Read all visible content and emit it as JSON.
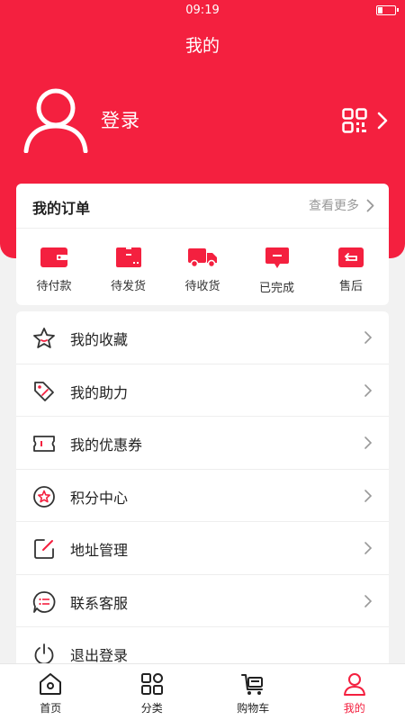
{
  "status_bar": {
    "time": "09:19"
  },
  "header": {
    "title": "我的"
  },
  "profile": {
    "login_label": "登录"
  },
  "orders": {
    "title": "我的订单",
    "more_label": "查看更多",
    "items": [
      {
        "label": "待付款",
        "icon": "wallet-icon"
      },
      {
        "label": "待发货",
        "icon": "box-icon"
      },
      {
        "label": "待收货",
        "icon": "truck-icon"
      },
      {
        "label": "已完成",
        "icon": "message-check-icon"
      },
      {
        "label": "售后",
        "icon": "return-icon"
      }
    ]
  },
  "menu": {
    "items": [
      {
        "label": "我的收藏",
        "icon": "star-icon"
      },
      {
        "label": "我的助力",
        "icon": "tag-icon"
      },
      {
        "label": "我的优惠券",
        "icon": "coupon-icon"
      },
      {
        "label": "积分中心",
        "icon": "points-star-icon"
      },
      {
        "label": "地址管理",
        "icon": "edit-address-icon"
      },
      {
        "label": "联系客服",
        "icon": "chat-icon"
      },
      {
        "label": "退出登录",
        "icon": "power-icon"
      }
    ]
  },
  "tabbar": {
    "items": [
      {
        "label": "首页",
        "icon": "home-icon"
      },
      {
        "label": "分类",
        "icon": "grid-icon"
      },
      {
        "label": "购物车",
        "icon": "cart-icon"
      },
      {
        "label": "我的",
        "icon": "user-icon",
        "active": true
      }
    ]
  },
  "colors": {
    "accent": "#f4203f",
    "background": "#f2f2f2"
  }
}
